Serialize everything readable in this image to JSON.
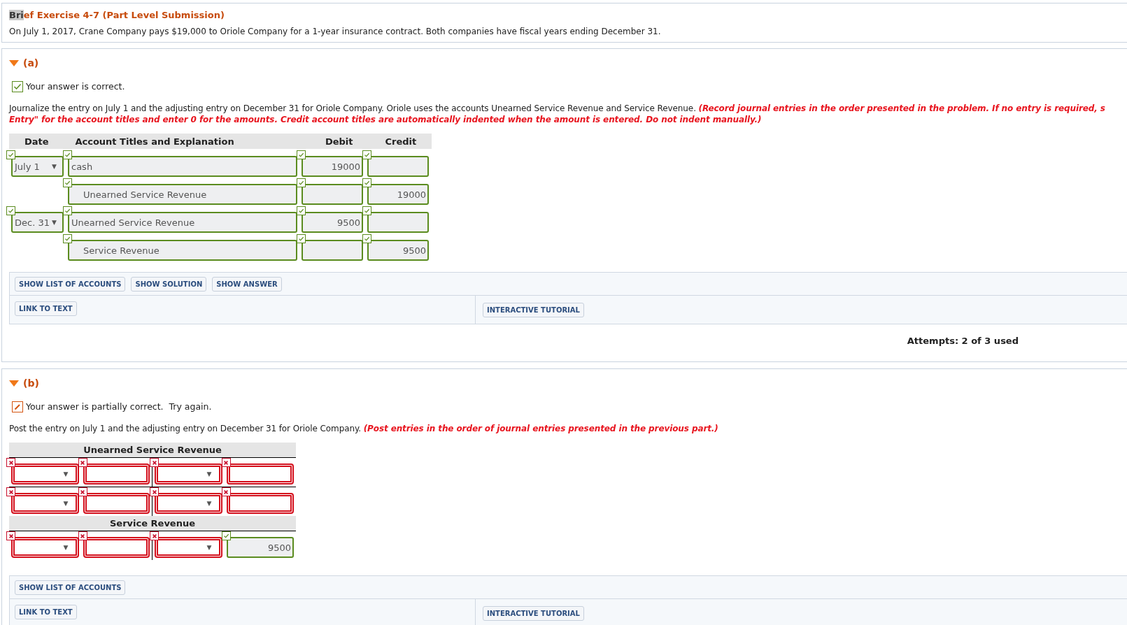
{
  "header": {
    "title_parts": [
      {
        "text": "Bri",
        "selected": true
      },
      {
        "text": "ef Exercise 4-7 (Part Level Submission)",
        "selected": false
      }
    ],
    "problem": "On July 1, 2017, Crane Company pays $19,000 to Oriole Company for a 1-year insurance contract. Both companies have fiscal years ending December 31."
  },
  "parts": [
    {
      "label": "(a)",
      "expanded": true,
      "correct": true,
      "feedback": "Your answer is correct.",
      "instructions": "Journalize the entry on July 1 and the adjusting entry on December 31 for Oriole Company. Oriole uses the accounts Unearned Service Revenue and Service Revenue.",
      "note_lines": [
        "(Record journal entries in the order presented in the problem. If no entry is required, s",
        "Entry\" for the account titles and enter 0 for the amounts. Credit account titles are automatically indented when the amount is entered. Do not indent manually.)"
      ],
      "kind": "journal",
      "journal": {
        "columns": [
          "Date",
          "Account Titles and Explanation",
          "Debit",
          "Credit"
        ],
        "rows": [
          {
            "date": {
              "value": "July 1",
              "arrow": "▼",
              "correct": true
            },
            "account": {
              "value": "cash",
              "correct": true,
              "indented": false
            },
            "debit": {
              "value": "19000",
              "correct": true
            },
            "credit": {
              "correct": true
            }
          },
          {
            "account": {
              "value": "Unearned Service Revenue",
              "correct": true,
              "indented": true
            },
            "debit": {
              "correct": true
            },
            "credit": {
              "value": "19000",
              "correct": true
            }
          },
          {
            "date": {
              "value": "Dec. 31",
              "arrow": "▼",
              "correct": true
            },
            "account": {
              "value": "Unearned Service Revenue",
              "correct": true,
              "indented": false
            },
            "debit": {
              "value": "9500",
              "correct": true
            },
            "credit": {
              "correct": true
            }
          },
          {
            "account": {
              "value": "Service Revenue",
              "correct": true,
              "indented": true
            },
            "debit": {
              "correct": true
            },
            "credit": {
              "value": "9500",
              "correct": true
            }
          }
        ]
      },
      "buttons": [
        "SHOW LIST OF ACCOUNTS",
        "SHOW SOLUTION",
        "SHOW ANSWER"
      ],
      "link_to_text": "LINK TO TEXT",
      "tutorial": "INTERACTIVE TUTORIAL",
      "attempts": "Attempts: 2 of 3 used"
    },
    {
      "label": "(b)",
      "expanded": true,
      "correct": false,
      "feedback": "Your answer is partially correct.  Try again.",
      "instructions": "Post the entry on July 1 and the adjusting entry on December 31 for Oriole Company.",
      "note_lines": [
        "(Post entries in the order of journal entries presented in the previous part.)"
      ],
      "kind": "t_accounts",
      "t_accounts": [
        {
          "title": "Unearned Service Revenue",
          "rows": [
            {
              "cells": [
                {
                  "kind": "select",
                  "arrow": "▼",
                  "correct": false
                },
                {
                  "kind": "input",
                  "correct": false
                },
                {
                  "kind": "select",
                  "arrow": "▼",
                  "correct": false
                },
                {
                  "kind": "input",
                  "correct": false
                }
              ]
            },
            {
              "cells": [
                {
                  "kind": "select",
                  "arrow": "▼",
                  "correct": false
                },
                {
                  "kind": "input",
                  "correct": false
                },
                {
                  "kind": "select",
                  "arrow": "▼",
                  "correct": false
                },
                {
                  "kind": "input",
                  "correct": false
                }
              ]
            }
          ]
        },
        {
          "title": "Service Revenue",
          "rows": [
            {
              "cells": [
                {
                  "kind": "select",
                  "arrow": "▼",
                  "correct": false
                },
                {
                  "kind": "input",
                  "correct": false
                },
                {
                  "kind": "select",
                  "arrow": "▼",
                  "correct": false
                },
                {
                  "kind": "input",
                  "value": "9500",
                  "correct": true
                }
              ]
            }
          ]
        }
      ],
      "buttons": [
        "SHOW LIST OF ACCOUNTS"
      ],
      "link_to_text": "LINK TO TEXT",
      "tutorial": "INTERACTIVE TUTORIAL"
    }
  ]
}
